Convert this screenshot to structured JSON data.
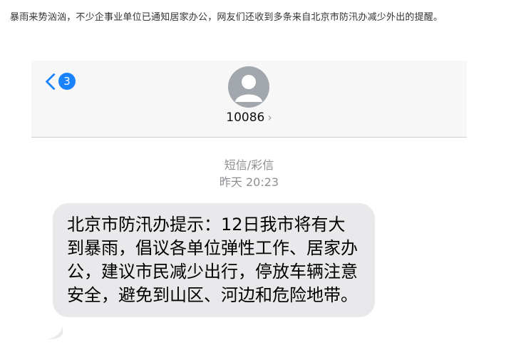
{
  "article": {
    "text": "暴雨来势汹汹，不少企事业单位已通知居家办公，网友们还收到多条来自北京市防汛办减少外出的提醒。"
  },
  "header": {
    "back_count": "3",
    "contact_name": "10086",
    "contact_arrow": "›"
  },
  "meta": {
    "type_label": "短信/彩信",
    "timestamp": "昨天 20:23"
  },
  "message": {
    "text": "北京市防汛办提示：12日我市将有大到暴雨，倡议各单位弹性工作、居家办公，建议市民减少出行，停放车辆注意安全，避免到山区、河边和危险地带。"
  },
  "colors": {
    "ios_blue": "#1a82fb",
    "bubble_gray": "#e9e9eb",
    "avatar_gray": "#a2a6ad"
  }
}
